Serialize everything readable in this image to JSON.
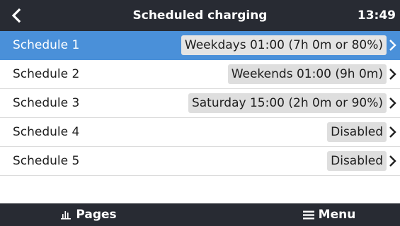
{
  "header": {
    "title": "Scheduled charging",
    "time": "13:49"
  },
  "schedules": [
    {
      "label": "Schedule 1",
      "value": "Weekdays 01:00 (7h 0m or 80%)",
      "selected": true
    },
    {
      "label": "Schedule 2",
      "value": "Weekends 01:00 (9h 0m)",
      "selected": false
    },
    {
      "label": "Schedule 3",
      "value": "Saturday 15:00 (2h 0m or 90%)",
      "selected": false
    },
    {
      "label": "Schedule 4",
      "value": "Disabled",
      "selected": false
    },
    {
      "label": "Schedule 5",
      "value": "Disabled",
      "selected": false
    }
  ],
  "footer": {
    "pages_label": "Pages",
    "menu_label": "Menu"
  },
  "colors": {
    "bar": "#282b33",
    "selected_row": "#4a90d9",
    "value_box": "#dedede"
  }
}
